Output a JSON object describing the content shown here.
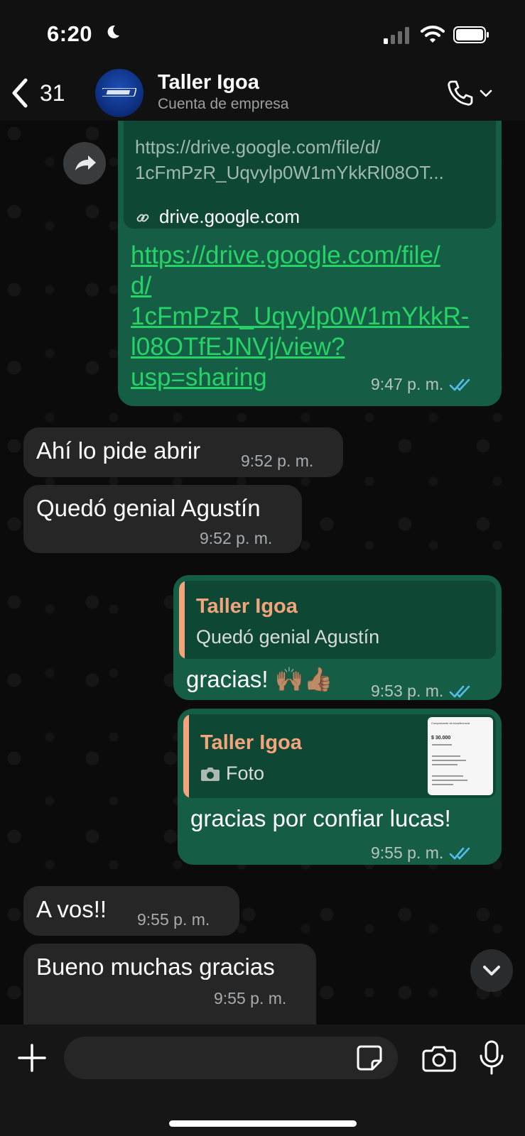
{
  "status_bar": {
    "time": "6:20"
  },
  "header": {
    "back_count": "31",
    "contact_name": "Taller Igoa",
    "contact_subtitle": "Cuenta de empresa"
  },
  "messages": {
    "link_message": {
      "preview_url_line1": "https://drive.google.com/file/d/",
      "preview_url_line2": "1cFmPzR_Uqvylp0W1mYkkRl08OT...",
      "preview_domain": "drive.google.com",
      "link_line1": "https://drive.google.com/file/",
      "link_line2": "d/",
      "link_line3": "1cFmPzR_Uqvylp0W1mYkkR-",
      "link_line4": "l08OTfEJNVj/view?",
      "link_line5": "usp=sharing",
      "time": "9:47 p. m."
    },
    "in1": {
      "text": "Ahí lo pide abrir",
      "time": "9:52 p. m."
    },
    "in2": {
      "text": "Quedó genial Agustín",
      "time": "9:52 p. m."
    },
    "out1": {
      "quote_author": "Taller Igoa",
      "quote_text": "Quedó genial Agustín",
      "text": "gracias! 🙌🏽👍🏽",
      "time": "9:53 p. m."
    },
    "out2": {
      "quote_author": "Taller Igoa",
      "quote_text": "Foto",
      "thumb_title": "Comprobante de transferencia",
      "thumb_amount": "$ 30.000",
      "text": "gracias por confiar lucas!",
      "time": "9:55 p. m."
    },
    "in3": {
      "text": "A vos!!",
      "time": "9:55 p. m."
    },
    "in4": {
      "text": "Bueno muchas gracias",
      "time": "9:55 p. m."
    }
  },
  "colors": {
    "outgoing_bubble": "#155d45",
    "incoming_bubble": "#262627",
    "quote_accent": "#f4a47c",
    "read_ticks": "#53bdeb"
  }
}
